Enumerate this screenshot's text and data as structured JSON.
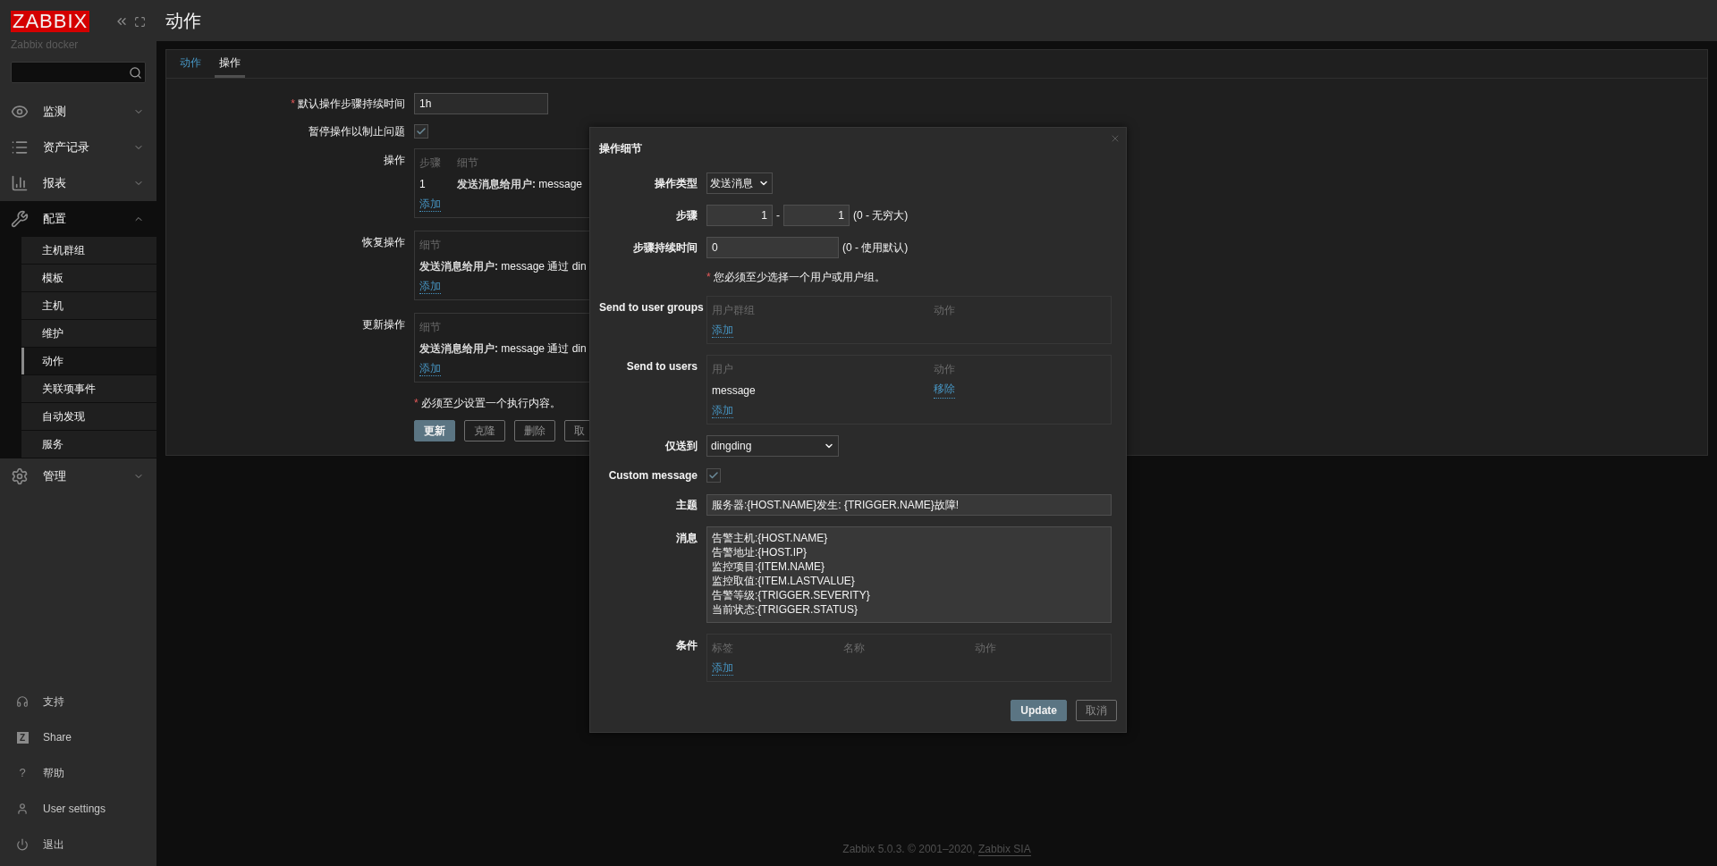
{
  "sidebar": {
    "logo": "ZABBIX",
    "server_name": "Zabbix docker",
    "menu": [
      {
        "label": "监测",
        "expanded": false
      },
      {
        "label": "资产记录",
        "expanded": false
      },
      {
        "label": "报表",
        "expanded": false
      },
      {
        "label": "配置",
        "expanded": true,
        "children": [
          {
            "label": "主机群组",
            "selected": false
          },
          {
            "label": "模板",
            "selected": false
          },
          {
            "label": "主机",
            "selected": false
          },
          {
            "label": "维护",
            "selected": false
          },
          {
            "label": "动作",
            "selected": true
          },
          {
            "label": "关联项事件",
            "selected": false
          },
          {
            "label": "自动发现",
            "selected": false
          },
          {
            "label": "服务",
            "selected": false
          }
        ]
      },
      {
        "label": "管理",
        "expanded": false
      }
    ],
    "bottom_menu": [
      {
        "label": "支持"
      },
      {
        "label": "Share",
        "icon_char": "Z"
      },
      {
        "label": "帮助",
        "icon_char": "?"
      },
      {
        "label": "User settings"
      },
      {
        "label": "退出"
      }
    ]
  },
  "page_title": "动作",
  "tabs": [
    {
      "label": "动作",
      "selected": false
    },
    {
      "label": "操作",
      "selected": true
    }
  ],
  "form": {
    "default_duration": {
      "required_mark": "*",
      "label": "默认操作步骤持续时间",
      "value": "1h"
    },
    "pause": {
      "label": "暂停操作以制止问题",
      "checked": true
    },
    "operations": {
      "label": "操作",
      "columns": [
        "步骤",
        "细节"
      ],
      "rows": [
        {
          "step": "1",
          "detail_bold": "发送消息给用户:",
          "detail": " message"
        }
      ],
      "add": "添加"
    },
    "recovery": {
      "label": "恢复操作",
      "columns": [
        "细节"
      ],
      "rows": [
        {
          "detail_bold": "发送消息给用户:",
          "detail": " message 通过 din"
        }
      ],
      "add": "添加"
    },
    "update_ops": {
      "label": "更新操作",
      "columns": [
        "细节"
      ],
      "rows": [
        {
          "detail_bold": "发送消息给用户:",
          "detail": " message 通过 din"
        }
      ],
      "add": "添加"
    },
    "note_mark": "*",
    "note": "必须至少设置一个执行内容。",
    "buttons": [
      {
        "label": "更新",
        "kind": "primary"
      },
      {
        "label": "克隆",
        "kind": "secondary"
      },
      {
        "label": "删除",
        "kind": "secondary"
      },
      {
        "label": "取",
        "kind": "secondary"
      }
    ]
  },
  "dialog": {
    "title": "操作细节",
    "op_type": {
      "label": "操作类型",
      "value": "发送消息"
    },
    "steps": {
      "label": "步骤",
      "from": "1",
      "separator": "-",
      "to": "1",
      "hint": "(0 - 无穷大)"
    },
    "step_duration": {
      "label": "步骤持续时间",
      "value": "0",
      "hint": "(0 - 使用默认)"
    },
    "note_mark": "*",
    "note": "您必须至少选择一个用户或用户组。",
    "user_groups": {
      "label": "Send to user groups",
      "columns": [
        "用户群组",
        "动作"
      ],
      "add": "添加"
    },
    "users": {
      "label": "Send to users",
      "columns": [
        "用户",
        "动作"
      ],
      "rows": [
        {
          "name": "message",
          "action": "移除"
        }
      ],
      "add": "添加"
    },
    "send_only_to": {
      "label": "仅送到",
      "value": "dingding"
    },
    "custom_message": {
      "label": "Custom message",
      "checked": true
    },
    "subject": {
      "label": "主题",
      "value": "服务器:{HOST.NAME}发生: {TRIGGER.NAME}故障!"
    },
    "message": {
      "label": "消息",
      "lines": [
        "告警主机:{HOST.NAME}",
        "告警地址:{HOST.IP}",
        "监控项目:{ITEM.NAME}",
        "监控取值:{ITEM.LASTVALUE}",
        "告警等级:{TRIGGER.SEVERITY}",
        "当前状态:{TRIGGER.STATUS}"
      ]
    },
    "conditions": {
      "label": "条件",
      "columns": [
        "标签",
        "名称",
        "动作"
      ],
      "add": "添加"
    },
    "buttons": [
      {
        "label": "Update",
        "kind": "primary"
      },
      {
        "label": "取消",
        "kind": "secondary"
      }
    ]
  },
  "footer": {
    "text": "Zabbix 5.0.3. © 2001–2020, ",
    "link": "Zabbix SIA"
  }
}
